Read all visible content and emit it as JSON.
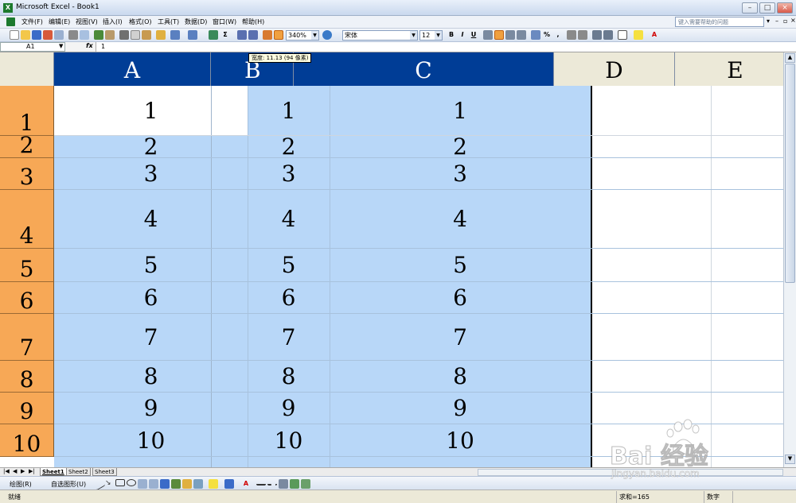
{
  "window": {
    "title": "Microsoft Excel - Book1"
  },
  "menu": [
    "文件(F)",
    "编辑(E)",
    "视图(V)",
    "插入(I)",
    "格式(O)",
    "工具(T)",
    "数据(D)",
    "窗口(W)",
    "帮助(H)"
  ],
  "help_placeholder": "键入需要帮助的问题",
  "toolbar": {
    "zoom": "340%",
    "font": "宋体",
    "size": "12",
    "bold": "B",
    "italic": "I",
    "underline": "U"
  },
  "formula_bar": {
    "name_box": "A1",
    "fx": "fx",
    "value": "1"
  },
  "tooltip": "宽度: 11.13 (94 像素)",
  "columns": [
    "A",
    "B",
    "C",
    "D",
    "E"
  ],
  "rows": [
    {
      "n": "1",
      "a": "1",
      "b": "1",
      "c": "1"
    },
    {
      "n": "2",
      "a": "2",
      "b": "2",
      "c": "2"
    },
    {
      "n": "3",
      "a": "3",
      "b": "3",
      "c": "3"
    },
    {
      "n": "4",
      "a": "4",
      "b": "4",
      "c": "4"
    },
    {
      "n": "5",
      "a": "5",
      "b": "5",
      "c": "5"
    },
    {
      "n": "6",
      "a": "6",
      "b": "6",
      "c": "6"
    },
    {
      "n": "7",
      "a": "7",
      "b": "7",
      "c": "7"
    },
    {
      "n": "8",
      "a": "8",
      "b": "8",
      "c": "8"
    },
    {
      "n": "9",
      "a": "9",
      "b": "9",
      "c": "9"
    },
    {
      "n": "10",
      "a": "10",
      "b": "10",
      "c": "10"
    }
  ],
  "sheets": [
    "Sheet1",
    "Sheet2",
    "Sheet3"
  ],
  "draw_toolbar": {
    "draw": "绘图(R)",
    "autoshapes": "自选图形(U)"
  },
  "status": {
    "ready": "就绪",
    "sum": "求和=165",
    "mode": "数字"
  },
  "watermark": {
    "brand": "Bai 经验",
    "url": "jingyan.baidu.com"
  },
  "colors": {
    "selection": "#b8d7f8",
    "header_selected": "#003d96",
    "row_header": "#f7a856"
  }
}
